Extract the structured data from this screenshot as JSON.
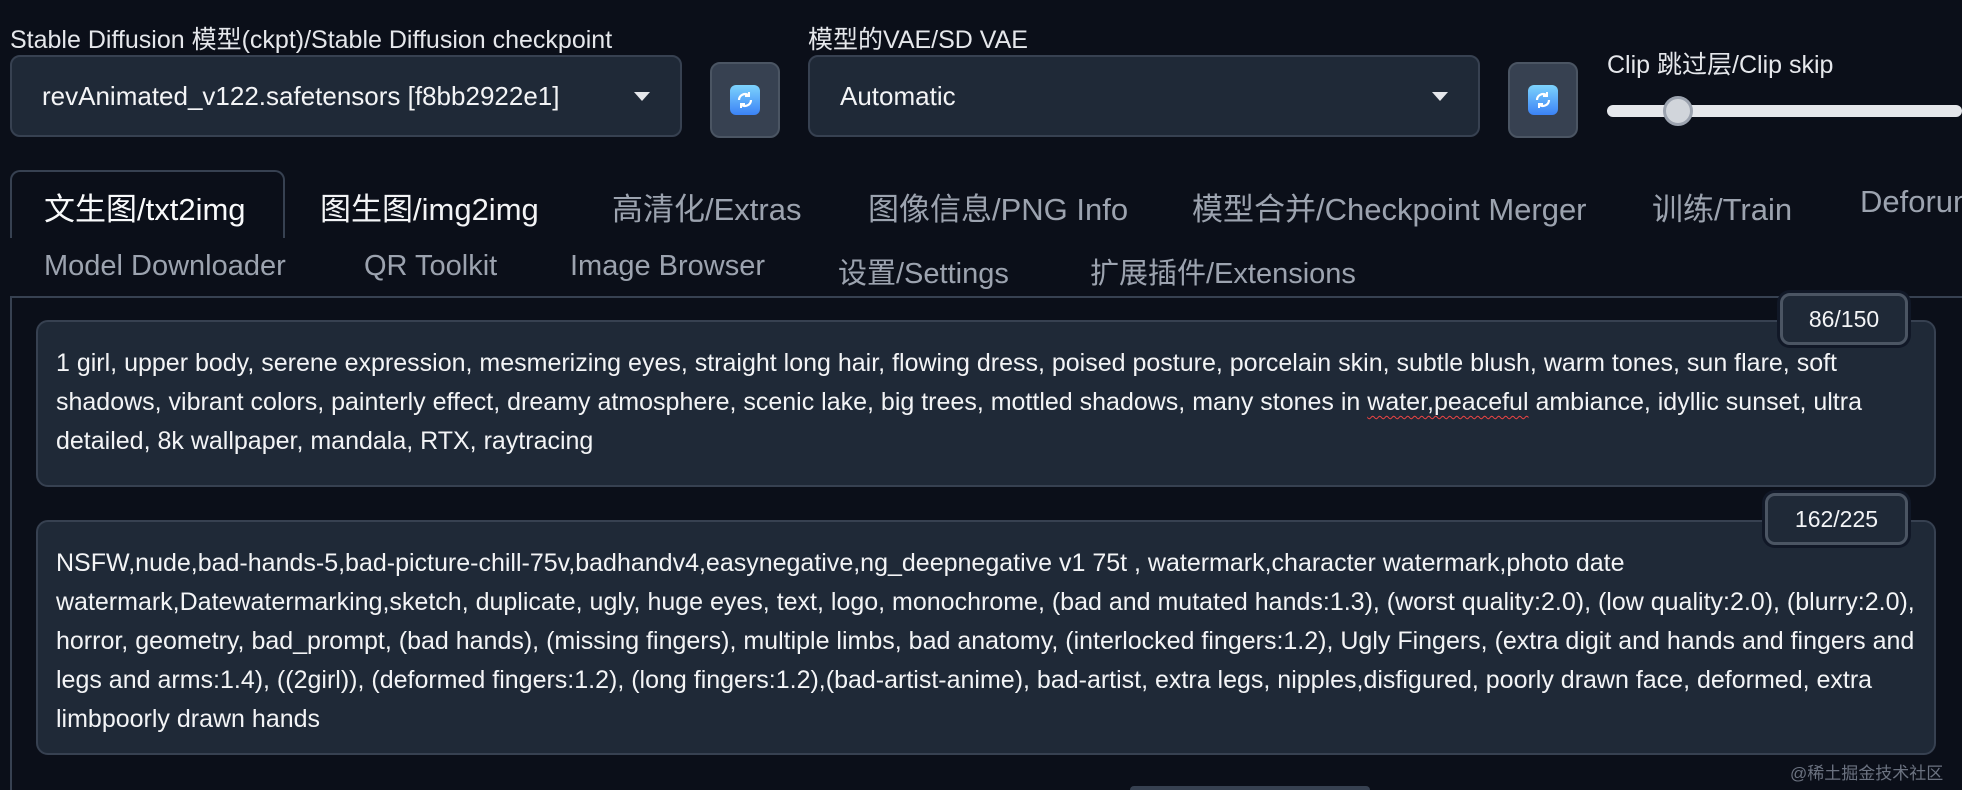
{
  "checkpoint": {
    "label": "Stable Diffusion 模型(ckpt)/Stable Diffusion checkpoint",
    "value": "revAnimated_v122.safetensors [f8bb2922e1]",
    "icon": "chevron-down-icon"
  },
  "vae": {
    "label": "模型的VAE/SD VAE",
    "value": "Automatic",
    "icon": "chevron-down-icon"
  },
  "refresh": {
    "icon": "refresh-icon",
    "glyph": "🔄"
  },
  "clip_skip": {
    "label": "Clip 跳过层/Clip skip",
    "level_fraction": 0.2
  },
  "tabs": [
    {
      "label": "文生图/txt2img",
      "active": true
    },
    {
      "label": "图生图/img2img"
    },
    {
      "label": "高清化/Extras"
    },
    {
      "label": "图像信息/PNG Info"
    },
    {
      "label": "模型合并/Checkpoint Merger"
    },
    {
      "label": "训练/Train"
    },
    {
      "label": "Deforum"
    }
  ],
  "tabs_row2": [
    {
      "label": "Model Downloader"
    },
    {
      "label": "QR Toolkit"
    },
    {
      "label": "Image Browser"
    },
    {
      "label": "设置/Settings"
    },
    {
      "label": "扩展插件/Extensions"
    }
  ],
  "prompt": {
    "token_count": "86/150",
    "text_before": "1 girl, upper body, serene expression, mesmerizing eyes, straight long hair, flowing dress, poised posture, porcelain skin, subtle blush, warm tones, sun flare, soft shadows, vibrant colors, painterly effect, dreamy atmosphere, scenic lake, big trees, mottled shadows, many stones in ",
    "text_squiggle": "water,peaceful",
    "text_after": " ambiance, idyllic sunset, ultra detailed, 8k wallpaper, mandala, RTX, raytracing"
  },
  "negative_prompt": {
    "token_count": "162/225",
    "text": "NSFW,nude,bad-hands-5,bad-picture-chill-75v,badhandv4,easynegative,ng_deepnegative v1 75t , watermark,character watermark,photo date watermark,Datewatermarking,sketch, duplicate, ugly, huge eyes, text, logo, monochrome, (bad and mutated hands:1.3), (worst quality:2.0), (low quality:2.0), (blurry:2.0), horror, geometry, bad_prompt, (bad hands), (missing fingers), multiple limbs, bad anatomy, (interlocked fingers:1.2), Ugly Fingers, (extra digit and hands and fingers and legs and arms:1.4), ((2girl)), (deformed fingers:1.2), (long fingers:1.2),(bad-artist-anime), bad-artist, extra legs, nipples,disfigured, poorly drawn face, deformed, extra limbpoorly drawn hands"
  },
  "watermark": "@稀土掘金技术社区",
  "colors": {
    "background": "#0b0f19",
    "panel": "#1f2937",
    "border": "#374151",
    "spellcheck": "#ef4444"
  }
}
